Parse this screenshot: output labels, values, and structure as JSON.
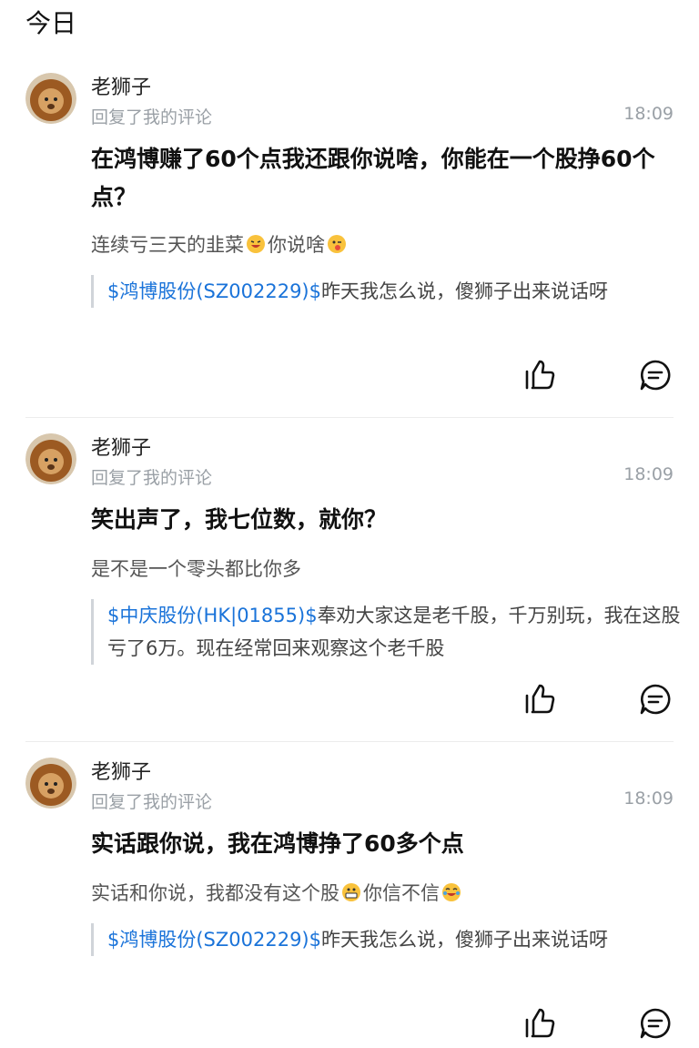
{
  "section_title": "今日",
  "notifications": [
    {
      "author": "老狮子",
      "action": "回复了我的评论",
      "time": "18:09",
      "reply": "在鸿博赚了60个点我还跟你说啥，你能在一个股挣60个点？",
      "my_comment_before": "连续亏三天的韭菜",
      "my_comment_after": "你说啥",
      "emoji1": "grinning-sweat-emoji",
      "emoji2": "winking-tongue-emoji",
      "quote_stock": "$鸿博股份(SZ002229)$",
      "quote_text": "昨天我怎么说，傻狮子出来说话呀"
    },
    {
      "author": "老狮子",
      "action": "回复了我的评论",
      "time": "18:09",
      "reply": "笑出声了，我七位数，就你？",
      "my_comment_before": "是不是一个零头都比你多",
      "my_comment_after": "",
      "quote_stock": "$中庆股份(HK|01855)$",
      "quote_text": "奉劝大家这是老千股，千万别玩，我在这股亏了6万。现在经常回来观察这个老千股"
    },
    {
      "author": "老狮子",
      "action": "回复了我的评论",
      "time": "18:09",
      "reply": "实话跟你说，我在鸿博挣了60多个点",
      "my_comment_before": "实话和你说，我都没有这个股",
      "my_comment_after": "你信不信",
      "emoji1": "grimacing-emoji",
      "emoji2": "crying-laughing-emoji",
      "quote_stock": "$鸿博股份(SZ002229)$",
      "quote_text": "昨天我怎么说，傻狮子出来说话呀"
    }
  ]
}
